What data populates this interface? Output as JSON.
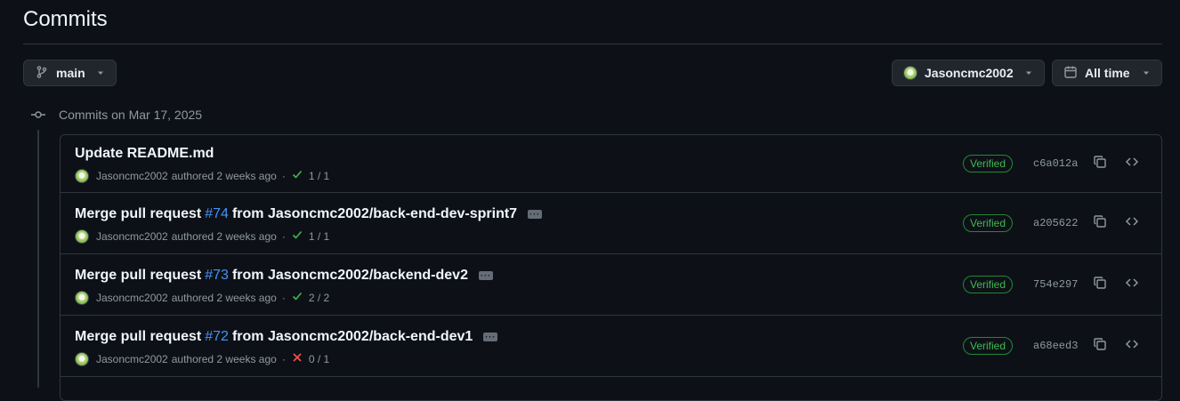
{
  "page": {
    "title": "Commits"
  },
  "filters": {
    "branch_label": "main",
    "author_label": "Jasoncmc2002",
    "time_label": "All time"
  },
  "group": {
    "heading": "Commits on Mar 17, 2025"
  },
  "commits": [
    {
      "message": "Update README.md",
      "prefix": "",
      "pr": "",
      "suffix": "",
      "author": "Jasoncmc2002",
      "authored_text": "authored 2 weeks ago",
      "separator": "·",
      "checks_status": "success",
      "checks": "1 / 1",
      "verified": "Verified",
      "sha": "c6a012a"
    },
    {
      "message": "",
      "prefix": "Merge pull request",
      "pr": "#74",
      "suffix": "from Jasoncmc2002/back-end-dev-sprint7",
      "author": "Jasoncmc2002",
      "authored_text": "authored 2 weeks ago",
      "separator": "·",
      "checks_status": "success",
      "checks": "1 / 1",
      "verified": "Verified",
      "sha": "a205622"
    },
    {
      "message": "",
      "prefix": "Merge pull request",
      "pr": "#73",
      "suffix": "from Jasoncmc2002/backend-dev2",
      "author": "Jasoncmc2002",
      "authored_text": "authored 2 weeks ago",
      "separator": "·",
      "checks_status": "success",
      "checks": "2 / 2",
      "verified": "Verified",
      "sha": "754e297"
    },
    {
      "message": "",
      "prefix": "Merge pull request",
      "pr": "#72",
      "suffix": "from Jasoncmc2002/back-end-dev1",
      "author": "Jasoncmc2002",
      "authored_text": "authored 2 weeks ago",
      "separator": "·",
      "checks_status": "failure",
      "checks": "0 / 1",
      "verified": "Verified",
      "sha": "a68eed3"
    }
  ],
  "colors": {
    "background": "#0d1117",
    "link": "#4493f8",
    "success": "#3fb950",
    "failure": "#f85149",
    "muted": "#9198a1"
  }
}
